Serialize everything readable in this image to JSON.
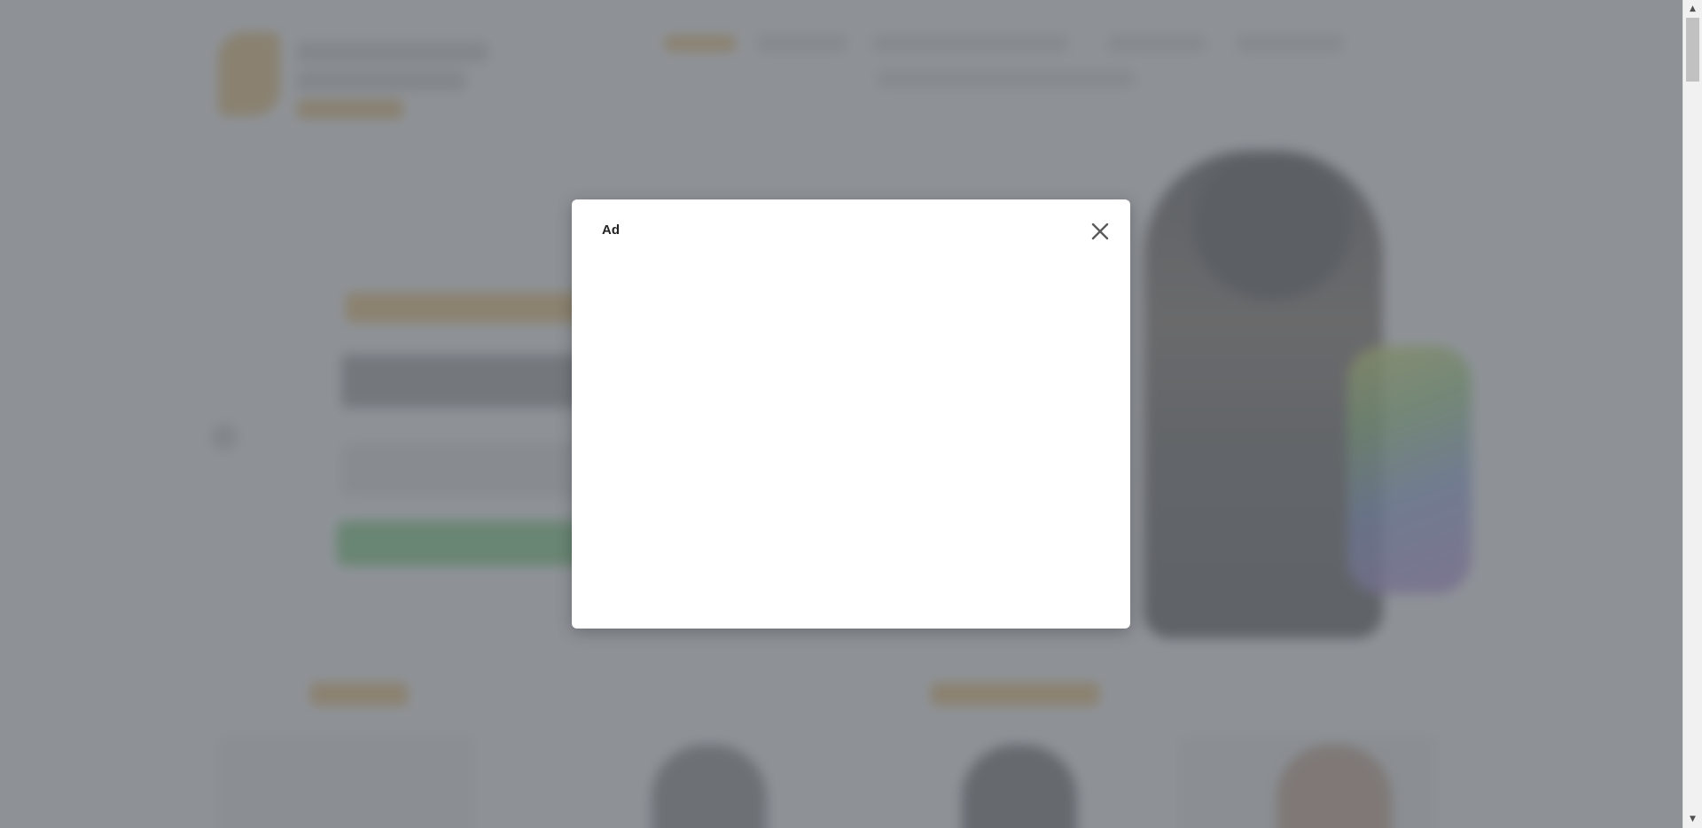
{
  "modal": {
    "title": "Ad",
    "close_icon": "close-icon"
  },
  "colors": {
    "overlay": "#6e737a",
    "modal_background": "#ffffff",
    "background_accent": "#f0b24a",
    "background_button": "#58c25a"
  },
  "scrollbar": {
    "up_icon": "scroll-up-arrow-icon",
    "down_icon": "scroll-down-arrow-icon",
    "scroll_position": 0
  }
}
